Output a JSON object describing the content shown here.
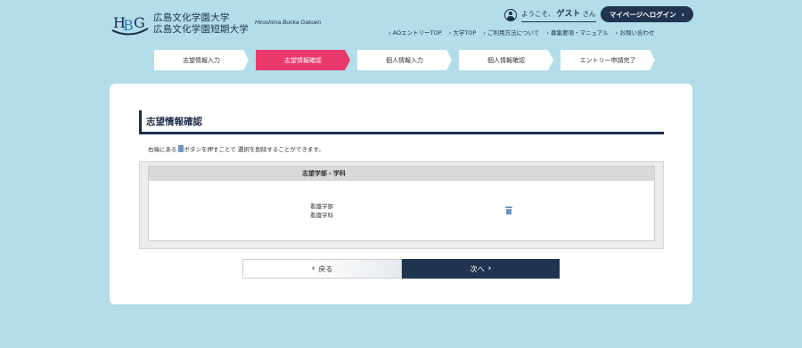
{
  "header": {
    "logo_names": [
      "広島文化学園大学",
      "広島文化学園短期大学"
    ],
    "logo_en": "Hiroshima Bunka Gakuen",
    "welcome_prefix": "ようこそ、",
    "user_name": "ゲスト",
    "welcome_suffix": "さん",
    "mypage_button": "マイページへログイン",
    "nav": [
      "AOエントリーTOP",
      "大学TOP",
      "ご利用方法について",
      "募集要項・マニュアル",
      "お問い合わせ"
    ]
  },
  "steps": [
    {
      "label": "志望情報入力",
      "active": false
    },
    {
      "label": "志望情報確認",
      "active": true
    },
    {
      "label": "個人情報入力",
      "active": false
    },
    {
      "label": "個人情報確認",
      "active": false
    },
    {
      "label": "エントリー申請完了",
      "active": false
    }
  ],
  "main": {
    "title": "志望情報確認",
    "note_before": "右端にある",
    "note_after": "ボタンを押すことで 選択を削除することができます。",
    "table_header": "志望学部・学科",
    "row": {
      "faculty": "看護学部",
      "department": "看護学科"
    },
    "back_button": "戻る",
    "next_button": "次へ"
  },
  "colors": {
    "background": "#b3dde8",
    "navy": "#213450",
    "active_step": "#e8386c",
    "trash_icon": "#6f93c4"
  },
  "icons": [
    "logo-mark",
    "user-icon",
    "trash-icon",
    "chevron-left-icon",
    "chevron-right-icon"
  ]
}
